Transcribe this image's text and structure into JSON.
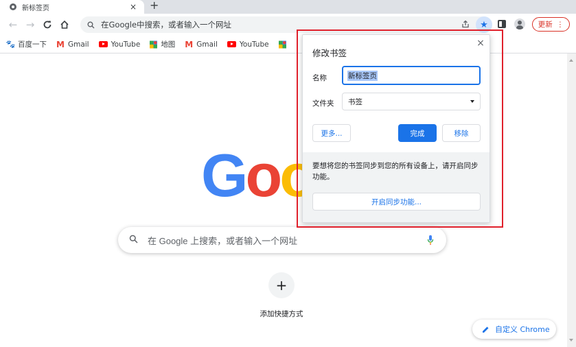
{
  "tab": {
    "title": "新标签页",
    "close": "×",
    "new_tab": "+"
  },
  "toolbar": {
    "back": "←",
    "forward": "→",
    "reload": "C",
    "home": "⌂",
    "omnibox_placeholder": "在Google中搜索，或者输入一个网址",
    "share": "⇪",
    "star": "★",
    "update_label": "更新",
    "menu": "⋮"
  },
  "bookmarks": [
    {
      "label": "百度一下",
      "icon": "baidu-icon"
    },
    {
      "label": "Gmail",
      "icon": "gmail-icon"
    },
    {
      "label": "YouTube",
      "icon": "youtube-icon"
    },
    {
      "label": "地图",
      "icon": "maps-icon"
    },
    {
      "label": "Gmail",
      "icon": "gmail-icon"
    },
    {
      "label": "YouTube",
      "icon": "youtube-icon"
    }
  ],
  "ntp": {
    "logo": {
      "g": "G",
      "o1": "o",
      "o2": "o"
    },
    "search_placeholder": "在 Google 上搜索，或者输入一个网址",
    "add_shortcut": "+",
    "add_shortcut_label": "添加快捷方式",
    "customize_label": "自定义 Chrome"
  },
  "dialog": {
    "title": "修改书签",
    "close": "×",
    "name_label": "名称",
    "name_value": "新标签页",
    "folder_label": "文件夹",
    "folder_value": "书签",
    "more_button": "更多...",
    "done_button": "完成",
    "remove_button": "移除",
    "sync_message": "要想将您的书签同步到您的所有设备上，请开启同步功能。",
    "sync_button": "开启同步功能..."
  },
  "colors": {
    "accent": "#1a73e8",
    "update_red": "#d93025",
    "highlight_red": "#e0202b"
  }
}
